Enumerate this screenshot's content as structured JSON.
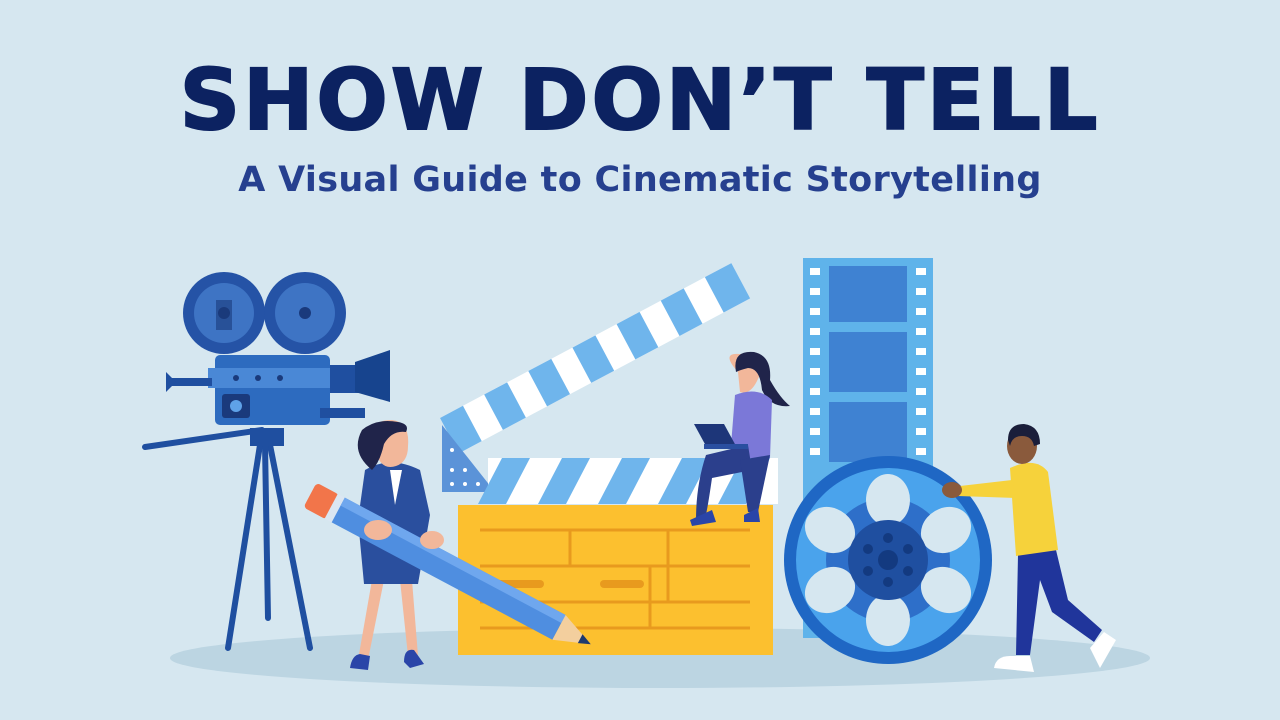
{
  "hero": {
    "title": "SHOW DON’T TELL",
    "subtitle": "A Visual Guide to Cinematic Storytelling"
  },
  "colors": {
    "background": "#d6e7f0",
    "title": "#0c2261",
    "subtitle": "#26408f",
    "clapper_board": "#fcc02f",
    "accent_blue": "#2e7bd6",
    "dark_blue": "#1f4fa0"
  },
  "illustration": {
    "icons": [
      "film-camera-icon",
      "clapperboard-icon",
      "film-strip-icon",
      "film-reel-icon",
      "pencil-icon",
      "laptop-icon"
    ],
    "people": [
      "woman-with-pencil",
      "woman-with-laptop",
      "man-rolling-reel"
    ]
  }
}
